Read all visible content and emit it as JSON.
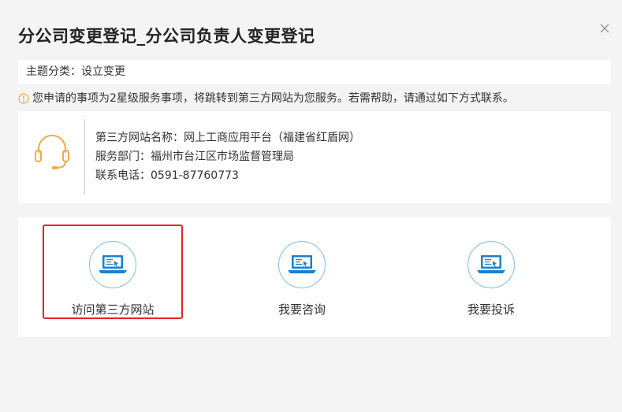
{
  "dialog": {
    "title": "分公司变更登记_分公司负责人变更登记",
    "close_icon": "close-icon"
  },
  "category": {
    "text": "主题分类：设立变更"
  },
  "notice": {
    "icon": "info-icon",
    "text": "您申请的事项为2星级服务事项，将跳转到第三方网站为您服务。若需帮助，请通过如下方式联系。"
  },
  "contact": {
    "icon": "headset-icon",
    "site_name": "第三方网站名称：网上工商应用平台（福建省红盾网）",
    "department": "服务部门：福州市台江区市场监督管理局",
    "phone": "联系电话：0591-87760773"
  },
  "actions": [
    {
      "label": "访问第三方网站",
      "icon": "laptop-icon",
      "highlighted": true
    },
    {
      "label": "我要咨询",
      "icon": "laptop-icon",
      "highlighted": false
    },
    {
      "label": "我要投诉",
      "icon": "laptop-icon",
      "highlighted": false
    }
  ],
  "colors": {
    "accent_orange": "#f2a944",
    "icon_blue": "#1a7fd0",
    "highlight_red": "#e62424"
  }
}
